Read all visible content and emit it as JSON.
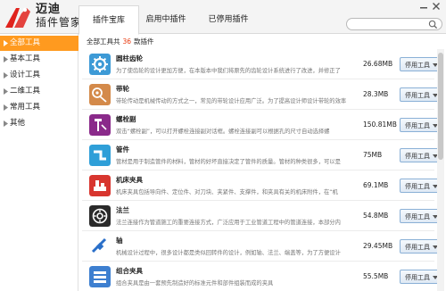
{
  "brand": {
    "line1": "迈迪",
    "line2": "插件管家"
  },
  "tabs": [
    {
      "label": "插件宝库",
      "active": true
    },
    {
      "label": "启用中插件",
      "active": false
    },
    {
      "label": "已停用插件",
      "active": false
    }
  ],
  "search": {
    "value": "",
    "placeholder": ""
  },
  "sidebar": {
    "items": [
      {
        "label": "全部工具",
        "active": true
      },
      {
        "label": "基本工具",
        "active": false
      },
      {
        "label": "设计工具",
        "active": false
      },
      {
        "label": "二维工具",
        "active": false
      },
      {
        "label": "常用工具",
        "active": false
      },
      {
        "label": "其他",
        "active": false
      }
    ]
  },
  "summary": {
    "prefix": "全部工具共",
    "count": "36",
    "suffix": "款插件"
  },
  "plugins": [
    {
      "name": "圆柱齿轮",
      "desc": "为了使齿轮的设计更加方便，在本版本中我们将原先的齿轮设计系统进行了改进，并修正了",
      "size": "26.68MB",
      "button": "停用工具",
      "icon": "gear-icon",
      "color": "#3d9ad6"
    },
    {
      "name": "带轮",
      "desc": "带轮传动是机械传动的方式之一，常见的带轮设计应用广泛。为了提高设计师设计带轮的效率",
      "size": "28.3MB",
      "button": "停用工具",
      "icon": "pulley-icon",
      "color": "#d48a4a"
    },
    {
      "name": "螺栓副",
      "desc": "双击“螺栓副”，可以打开螺栓连接副对话框。螺栓连接副可以根据孔的尺寸自动选择螺",
      "size": "150.81MB",
      "button": "停用工具",
      "icon": "bolt-icon",
      "color": "#8a2a8a"
    },
    {
      "name": "管件",
      "desc": "管材是用于制造管件的材料，管材的好坏直接决定了管件的质量。管材的种类很多，可以是",
      "size": "75MB",
      "button": "停用工具",
      "icon": "pipe-icon",
      "color": "#2f9fd8"
    },
    {
      "name": "机床夹具",
      "desc": "机床夹具包括导向件、定位件、对刀块、夹紧件、支撑件，和夹具有关的机床附件，在“机",
      "size": "69.1MB",
      "button": "停用工具",
      "icon": "fixture-icon",
      "color": "#d8362f"
    },
    {
      "name": "法兰",
      "desc": "法兰连接作为管道施工的重要连接方式，广泛应用于工业管道工程中的管道连接，本部分内",
      "size": "54.8MB",
      "button": "停用工具",
      "icon": "flange-icon",
      "color": "#2a2a2a"
    },
    {
      "name": "轴",
      "desc": "机械设计过程中，很多设计都是类似回转件的设计，例如轴、法兰、端盖等，为了方便设计",
      "size": "29.45MB",
      "button": "停用工具",
      "icon": "shaft-icon",
      "color": "#2a6fc9"
    },
    {
      "name": "组合夹具",
      "desc": "组合夹具是由一套预先制造好的标准元件和部件组装而成的夹具",
      "size": "55.5MB",
      "button": "停用工具",
      "icon": "modular-fixture-icon",
      "color": "#3d7fd0"
    }
  ]
}
